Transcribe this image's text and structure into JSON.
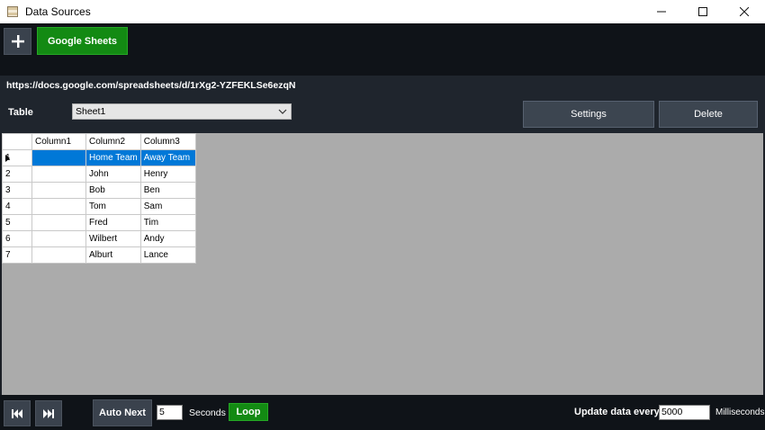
{
  "window": {
    "title": "Data Sources",
    "controls": [
      "minimize-icon",
      "maximize-icon",
      "close-icon"
    ]
  },
  "toolbar": {
    "add_icon": "plus-icon",
    "source_button_label": "Google Sheets",
    "accent_color": "#138a13"
  },
  "source": {
    "url": "https://docs.google.com/spreadsheets/d/1rXg2-YZFEKLSe6ezqN",
    "table_label": "Table",
    "table_selected": "Sheet1",
    "settings_label": "Settings",
    "delete_label": "Delete"
  },
  "grid": {
    "columns": [
      "Column1",
      "Column2",
      "Column3"
    ],
    "selection_color": "#0078d7",
    "rows": [
      {
        "num": "1",
        "c1": "",
        "c2": "Home Team",
        "c3": "Away Team",
        "selected": true
      },
      {
        "num": "2",
        "c1": "",
        "c2": "John",
        "c3": "Henry"
      },
      {
        "num": "3",
        "c1": "",
        "c2": "Bob",
        "c3": "Ben"
      },
      {
        "num": "4",
        "c1": "",
        "c2": "Tom",
        "c3": "Sam"
      },
      {
        "num": "5",
        "c1": "",
        "c2": "Fred",
        "c3": "Tim"
      },
      {
        "num": "6",
        "c1": "",
        "c2": "Wilbert",
        "c3": "Andy"
      },
      {
        "num": "7",
        "c1": "",
        "c2": "Alburt",
        "c3": "Lance"
      }
    ]
  },
  "bottom": {
    "first_icon": "skip-to-start-icon",
    "last_icon": "skip-to-end-icon",
    "auto_next_label": "Auto Next",
    "seconds_value": "5",
    "seconds_label": "Seconds",
    "loop_label": "Loop",
    "update_label": "Update data every",
    "update_value": "5000",
    "ms_label": "Milliseconds"
  }
}
